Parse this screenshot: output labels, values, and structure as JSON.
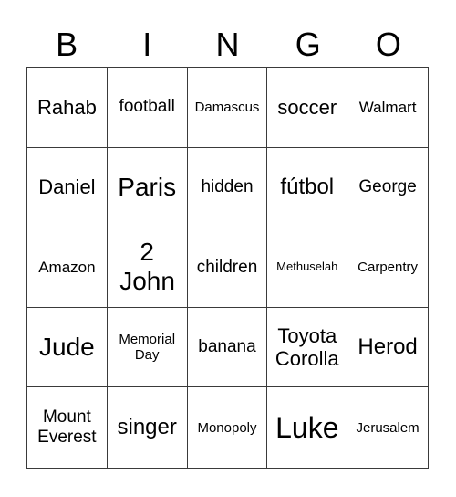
{
  "header": {
    "letters": [
      "B",
      "I",
      "N",
      "G",
      "O"
    ]
  },
  "board": {
    "cells": [
      [
        "Rahab",
        "football",
        "Damascus",
        "soccer",
        "Walmart"
      ],
      [
        "Daniel",
        "Paris",
        "hidden",
        "fútbol",
        "George"
      ],
      [
        "Amazon",
        "2 John",
        "children",
        "Methuselah",
        "Carpentry"
      ],
      [
        "Jude",
        "Memorial Day",
        "banana",
        "Toyota Corolla",
        "Herod"
      ],
      [
        "Mount Everest",
        "singer",
        "Monopoly",
        "Luke",
        "Jerusalem"
      ]
    ]
  }
}
